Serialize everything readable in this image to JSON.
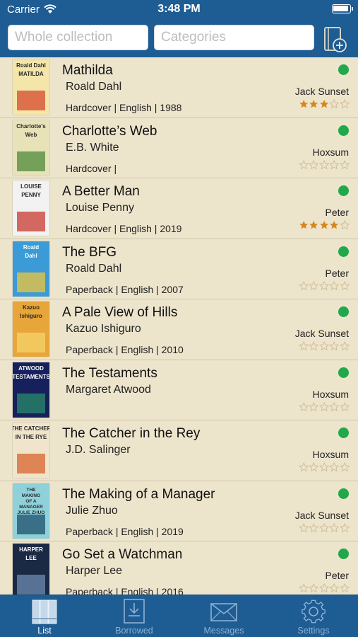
{
  "status_bar": {
    "carrier": "Carrier",
    "time": "3:48 PM"
  },
  "search": {
    "collection_placeholder": "Whole collection",
    "categories_placeholder": "Categories"
  },
  "books": [
    {
      "title": "Mathilda",
      "author": "Roald Dahl",
      "details": "Hardcover | English | 1988",
      "location": "Jack Sunset",
      "rating": 3,
      "cover_text": [
        "Roald Dahl",
        "MATILDA"
      ],
      "cover_colors": [
        "#f4e6a8",
        "#d64a2c"
      ]
    },
    {
      "title": "Charlotte’s Web",
      "author": "E.B. White",
      "details": "Hardcover |",
      "location": "Hoxsum",
      "rating": 0,
      "cover_text": [
        "Charlotte's",
        "Web"
      ],
      "cover_colors": [
        "#e8e2b8",
        "#4f8a3a"
      ]
    },
    {
      "title": "A Better Man",
      "author": "Louise Penny",
      "details": "Hardcover | English | 2019",
      "location": "Peter",
      "rating": 4,
      "cover_text": [
        "LOUISE",
        "PENNY"
      ],
      "cover_colors": [
        "#f2f2f2",
        "#c73a2f"
      ]
    },
    {
      "title": "The BFG",
      "author": "Roald Dahl",
      "details": "Paperback | English | 2007",
      "location": "Peter",
      "rating": 0,
      "cover_text": [
        "Roald",
        "Dahl"
      ],
      "cover_colors": [
        "#3a9bd6",
        "#f2c53a"
      ]
    },
    {
      "title": "A Pale View of Hills",
      "author": "Kazuo Ishiguro",
      "details": "Paperback | English | 2010",
      "location": "Jack Sunset",
      "rating": 0,
      "cover_text": [
        "Kazuo",
        "Ishiguro"
      ],
      "cover_colors": [
        "#e8a63a",
        "#f4d36a"
      ]
    },
    {
      "title": "The Testaments",
      "author": "Margaret Atwood",
      "details": "",
      "location": "Hoxsum",
      "rating": 0,
      "cover_text": [
        "ATWOOD",
        "TESTAMENTS"
      ],
      "cover_colors": [
        "#16205c",
        "#2a8a6a"
      ]
    },
    {
      "title": "The Catcher in the Rey",
      "author": "J.D. Salinger",
      "details": "",
      "location": "Hoxsum",
      "rating": 0,
      "cover_text": [
        "THE CATCHER",
        "IN THE RYE"
      ],
      "cover_colors": [
        "#f1e4cc",
        "#d7642e"
      ]
    },
    {
      "title": "The Making of a Manager",
      "author": "Julie Zhuo",
      "details": "Paperback | English | 2019",
      "location": "Jack Sunset",
      "rating": 0,
      "cover_text": [
        "THE",
        "MAKING",
        "OF A",
        "MANAGER",
        "JULIE ZHUO"
      ],
      "cover_colors": [
        "#8fd1da",
        "#1d4f6b"
      ]
    },
    {
      "title": "Go Set a Watchman",
      "author": "Harper Lee",
      "details": "Paperback | English | 2016",
      "location": "Peter",
      "rating": 0,
      "cover_text": [
        "HARPER",
        "LEE"
      ],
      "cover_colors": [
        "#1b2a44",
        "#6c8bb0"
      ]
    }
  ],
  "colors": {
    "accent": "#1e5c94",
    "list_background": "#ede4cc",
    "status_available": "#21a84a",
    "star_filled": "#d8871f",
    "star_empty": "#c9b98f"
  },
  "tabs": [
    {
      "label": "List",
      "icon": "books-icon",
      "active": true
    },
    {
      "label": "Borrowed",
      "icon": "download-tray-icon",
      "active": false
    },
    {
      "label": "Messages",
      "icon": "envelope-icon",
      "active": false
    },
    {
      "label": "Settings",
      "icon": "gear-icon",
      "active": false
    }
  ]
}
